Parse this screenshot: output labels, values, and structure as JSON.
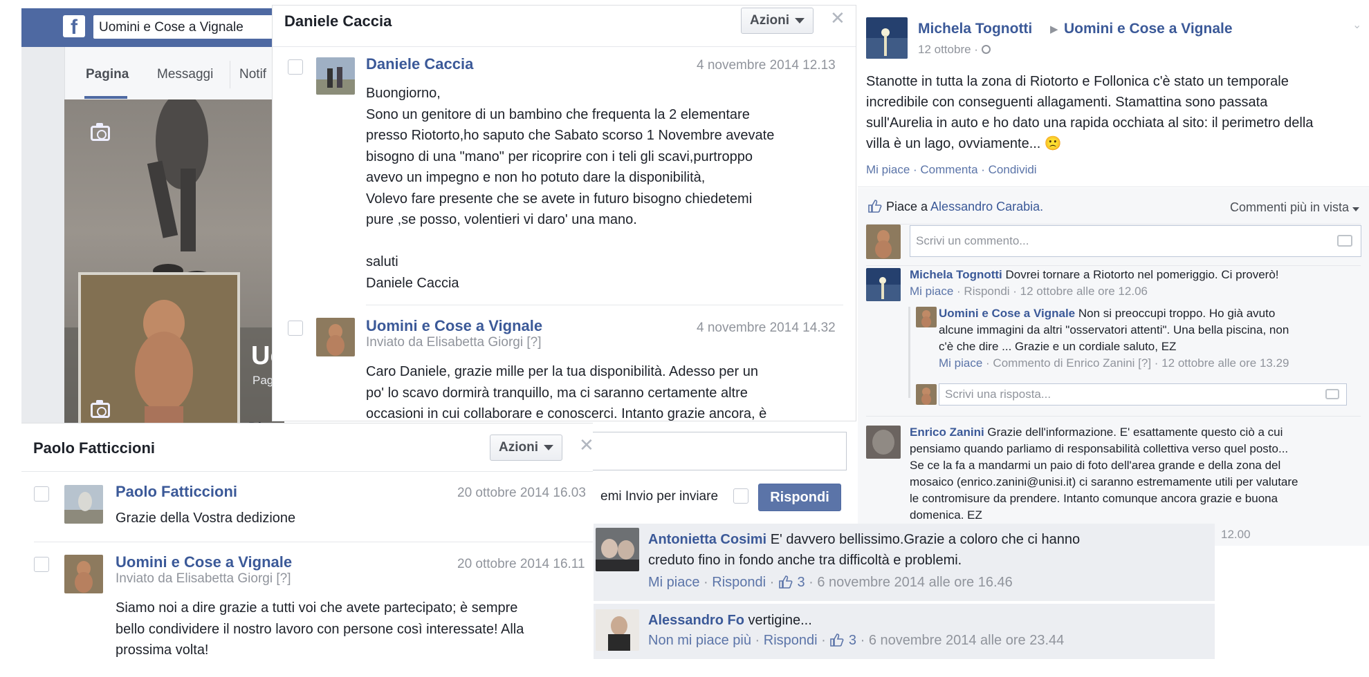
{
  "fb_page": {
    "logo": "facebook-f-icon",
    "search_value": "Uomini e Cose a Vignale",
    "tabs": [
      "Pagina",
      "Messaggi",
      "Notif"
    ],
    "cover_partial_title": "Uo",
    "cover_partial_sub": "Pag",
    "partial_text": "Di"
  },
  "chat_daniele": {
    "header": "Daniele Caccia",
    "actions_label": "Azioni",
    "close": "✕",
    "messages": [
      {
        "author": "Daniele Caccia",
        "time": "4 novembre 2014 12.13",
        "lines": [
          "Buongiorno,",
          "Sono un genitore di un bambino che frequenta la 2 elementare",
          "presso Riotorto,ho saputo che Sabato scorso 1 Novembre avevate",
          "bisogno di una \"mano\" per ricoprire con i teli gli scavi,purtroppo",
          "avevo un impegno e non ho potuto dare la disponibilità,",
          "Volevo fare presente che se avete in futuro bisogno chiedetemi",
          "pure ,se posso, volentieri vi daro' una mano.",
          "",
          "saluti",
          "Daniele Caccia"
        ]
      },
      {
        "author": "Uomini e Cose a Vignale",
        "sub": "Inviato da Elisabetta Giorgi [?]",
        "time": "4 novembre 2014 14.32",
        "lines": [
          "Caro Daniele, grazie mille per la tua disponibilità. Adesso per un",
          "po' lo scavo dormirà tranquillo, ma ci saranno certamente altre",
          "occasioni in cui collaborare e conoscerci. Intanto grazie ancora, è"
        ]
      }
    ],
    "enter_to_send": "emi Invio per inviare",
    "reply_button": "Rispondi"
  },
  "chat_paolo": {
    "header": "Paolo Fatticcioni",
    "actions_label": "Azioni",
    "close": "✕",
    "messages": [
      {
        "author": "Paolo Fatticcioni",
        "time": "20 ottobre 2014 16.03",
        "lines": [
          "Grazie della Vostra dedizione"
        ]
      },
      {
        "author": "Uomini e Cose a Vignale",
        "sub": "Inviato da Elisabetta Giorgi [?]",
        "time": "20 ottobre 2014 16.11",
        "lines": [
          "Siamo noi a dire grazie a tutti voi che avete partecipato; è sempre",
          "bello condividere il nostro lavoro con persone così interessate! Alla",
          "prossima volta!"
        ]
      }
    ]
  },
  "post_michela": {
    "author": "Michela Tognotti",
    "arrow": "▶",
    "target": "Uomini e Cose a Vignale",
    "date": "12 ottobre · ",
    "body_lines": [
      "Stanotte in tutta la zona di Riotorto e Follonica c'è stato un temporale",
      "incredibile con conseguenti allagamenti. Stamattina sono passata",
      "sull'Aurelia in auto e ho dato una rapida occhiata al sito: il perimetro della",
      "villa è un lago, ovviamente... 🙁"
    ],
    "actions": "Mi piace · Commenta · Condividi",
    "likes_text_prefix": "Piace a ",
    "likes_name": "Alessandro Carabia.",
    "sort_label": "Commenti più in vista",
    "comment_placeholder": "Scrivi un commento...",
    "comments": [
      {
        "author": "Michela Tognotti",
        "text": "Dovrei tornare a Riotorto nel pomeriggio. Ci proverò!",
        "meta_like": "Mi piace",
        "meta_rest": " · Rispondi · 12 ottobre alle ore 12.06"
      },
      {
        "author": "Uomini e Cose a Vignale",
        "text_lines": [
          "Non si preoccupi troppo. Ho già avuto",
          "alcune immagini da altri \"osservatori attenti\". Una bella piscina, non",
          "c'è che dire ... Grazie e un cordiale saluto, EZ"
        ],
        "meta_like": "Mi piace",
        "meta_rest": " · Commento di Enrico Zanini [?] · 12 ottobre alle ore 13.29"
      },
      {
        "author": "Enrico Zanini",
        "text_lines": [
          "Grazie dell'informazione. E' esattamente questo ciò a cui",
          "pensiamo quando parliamo di responsabilità collettiva verso quel posto...",
          "Se ce la fa a mandarmi un paio di foto dell'area grande e della zona del",
          "mosaico (enrico.zanini@unisi.it) ci saranno estremamente utili per valutare",
          "le contromisure da prendere. Intanto comunque ancora grazie e buona",
          "domenica. EZ"
        ],
        "partial_time": "12.00"
      }
    ],
    "reply_placeholder": "Scrivi una risposta..."
  },
  "comments_bottom": [
    {
      "author": "Antonietta Cosimi",
      "text_first": "E' davvero bellissimo.Grazie a coloro che ci hanno",
      "text_second": "creduto fino in fondo anche tra difficoltà e problemi.",
      "like": "Mi piace",
      "reply": "Rispondi",
      "likes": "3",
      "time": "6 novembre 2014 alle ore 16.46"
    },
    {
      "author": "Alessandro Fo",
      "text_first": "vertigine...",
      "like": "Non mi piace più",
      "reply": "Rispondi",
      "likes": "3",
      "time": "6 novembre 2014 alle ore 23.44"
    }
  ],
  "colors": {
    "fb_blue": "#3b5998",
    "fb_header": "#4e69a2",
    "reply_button": "#5b74a8",
    "grey_text": "#90949c",
    "comment_bg": "#eceef2"
  }
}
